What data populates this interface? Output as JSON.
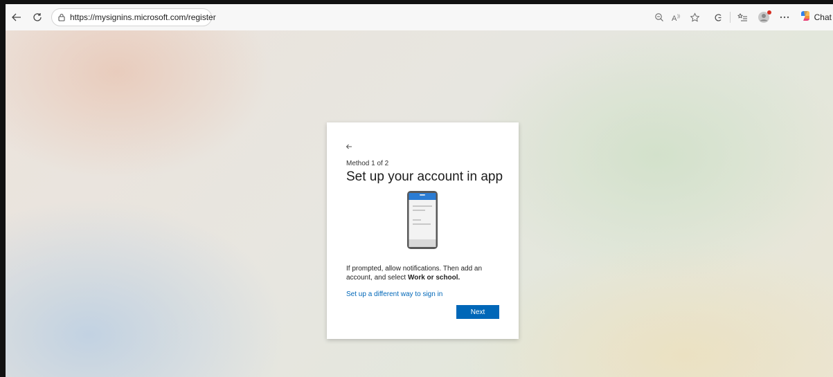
{
  "browser": {
    "url": "https://mysignins.microsoft.com/register",
    "chat_label": "Chat",
    "icons": [
      "back-arrow-icon",
      "refresh-icon",
      "lock-icon",
      "zoom-out-icon",
      "read-aloud-icon",
      "favorite-star-icon",
      "extensions-icon",
      "collections-icon",
      "profile-avatar-icon",
      "more-icon",
      "copilot-icon"
    ]
  },
  "card": {
    "step": "Method 1 of 2",
    "title": "Set up your account in app",
    "description_prefix": "If prompted, allow notifications. Then add an account, and select ",
    "description_bold": "Work or school.",
    "alt_link": "Set up a different way to sign in",
    "next_button": "Next"
  },
  "colors": {
    "accent": "#0067b8",
    "phone_header": "#2b7cd3",
    "phone_frame": "#585858"
  }
}
